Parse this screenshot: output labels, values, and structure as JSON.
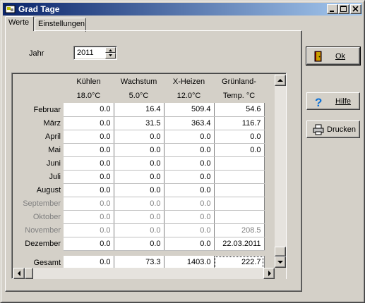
{
  "window": {
    "title": "Grad Tage"
  },
  "tabs": [
    {
      "label": "Werte",
      "active": true
    },
    {
      "label": "Einstellungen",
      "active": false
    }
  ],
  "year": {
    "label": "Jahr",
    "value": "2011"
  },
  "grid": {
    "columns": [
      {
        "line1": "Kühlen",
        "line2": "18.0°C"
      },
      {
        "line1": "Wachstum",
        "line2": "5.0°C"
      },
      {
        "line1": "X-Heizen",
        "line2": "12.0°C"
      },
      {
        "line1": "Grünland-",
        "line2": "Temp. °C"
      }
    ],
    "rows": [
      {
        "label": "Februar",
        "values": [
          "0.0",
          "16.4",
          "509.4",
          "54.6"
        ],
        "dimmed": false
      },
      {
        "label": "März",
        "values": [
          "0.0",
          "31.5",
          "363.4",
          "116.7"
        ],
        "dimmed": false
      },
      {
        "label": "April",
        "values": [
          "0.0",
          "0.0",
          "0.0",
          "0.0"
        ],
        "dimmed": false
      },
      {
        "label": "Mai",
        "values": [
          "0.0",
          "0.0",
          "0.0",
          "0.0"
        ],
        "dimmed": false
      },
      {
        "label": "Juni",
        "values": [
          "0.0",
          "0.0",
          "0.0",
          ""
        ],
        "dimmed": false
      },
      {
        "label": "Juli",
        "values": [
          "0.0",
          "0.0",
          "0.0",
          ""
        ],
        "dimmed": false
      },
      {
        "label": "August",
        "values": [
          "0.0",
          "0.0",
          "0.0",
          ""
        ],
        "dimmed": false
      },
      {
        "label": "September",
        "values": [
          "0.0",
          "0.0",
          "0.0",
          ""
        ],
        "dimmed": true
      },
      {
        "label": "Oktober",
        "values": [
          "0.0",
          "0.0",
          "0.0",
          ""
        ],
        "dimmed": true
      },
      {
        "label": "November",
        "values": [
          "0.0",
          "0.0",
          "0.0",
          "208.5"
        ],
        "dimmed": true
      },
      {
        "label": "Dezember",
        "values": [
          "0.0",
          "0.0",
          "0.0",
          "22.03.2011"
        ],
        "dimmed": false
      }
    ],
    "total": {
      "label": "Gesamt",
      "values": [
        "0.0",
        "73.3",
        "1403.0",
        "222.7"
      ]
    }
  },
  "buttons": {
    "ok": "Ok",
    "help": "Hilfe",
    "print": "Drucken"
  },
  "icons": {
    "ok": "door-exit-icon",
    "help": "question-mark-icon",
    "print": "printer-icon"
  },
  "colors": {
    "title_start": "#0a246a",
    "title_end": "#a6caf0",
    "face": "#d4d0c8",
    "help_icon": "#0a6fd6"
  }
}
